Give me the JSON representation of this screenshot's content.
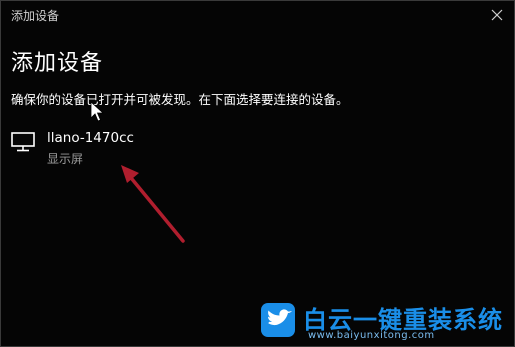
{
  "window": {
    "title": "添加设备",
    "close_icon": "close-icon"
  },
  "main": {
    "heading": "添加设备",
    "instruction": "确保你的设备已打开并可被发现。在下面选择要连接的设备。"
  },
  "devices": [
    {
      "name": "llano-1470cc",
      "type": "显示屏",
      "icon": "monitor-icon"
    }
  ],
  "watermark": {
    "title": "白云一键重装系统",
    "url": "www.baiyunxitong.com",
    "logo_icon": "bird-icon"
  },
  "colors": {
    "background": "#050505",
    "text_primary": "#ffffff",
    "text_secondary": "#9a9a9a",
    "annotation_arrow": "#b01e2e",
    "watermark_accent": "#1a8ee8"
  }
}
